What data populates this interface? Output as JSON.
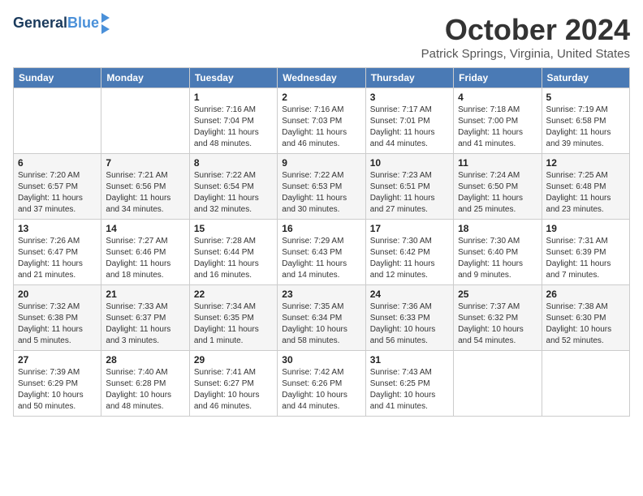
{
  "header": {
    "logo_line1": "General",
    "logo_line2": "Blue",
    "month_title": "October 2024",
    "location": "Patrick Springs, Virginia, United States"
  },
  "weekdays": [
    "Sunday",
    "Monday",
    "Tuesday",
    "Wednesday",
    "Thursday",
    "Friday",
    "Saturday"
  ],
  "weeks": [
    [
      {
        "day": "",
        "info": ""
      },
      {
        "day": "",
        "info": ""
      },
      {
        "day": "1",
        "info": "Sunrise: 7:16 AM\nSunset: 7:04 PM\nDaylight: 11 hours and 48 minutes."
      },
      {
        "day": "2",
        "info": "Sunrise: 7:16 AM\nSunset: 7:03 PM\nDaylight: 11 hours and 46 minutes."
      },
      {
        "day": "3",
        "info": "Sunrise: 7:17 AM\nSunset: 7:01 PM\nDaylight: 11 hours and 44 minutes."
      },
      {
        "day": "4",
        "info": "Sunrise: 7:18 AM\nSunset: 7:00 PM\nDaylight: 11 hours and 41 minutes."
      },
      {
        "day": "5",
        "info": "Sunrise: 7:19 AM\nSunset: 6:58 PM\nDaylight: 11 hours and 39 minutes."
      }
    ],
    [
      {
        "day": "6",
        "info": "Sunrise: 7:20 AM\nSunset: 6:57 PM\nDaylight: 11 hours and 37 minutes."
      },
      {
        "day": "7",
        "info": "Sunrise: 7:21 AM\nSunset: 6:56 PM\nDaylight: 11 hours and 34 minutes."
      },
      {
        "day": "8",
        "info": "Sunrise: 7:22 AM\nSunset: 6:54 PM\nDaylight: 11 hours and 32 minutes."
      },
      {
        "day": "9",
        "info": "Sunrise: 7:22 AM\nSunset: 6:53 PM\nDaylight: 11 hours and 30 minutes."
      },
      {
        "day": "10",
        "info": "Sunrise: 7:23 AM\nSunset: 6:51 PM\nDaylight: 11 hours and 27 minutes."
      },
      {
        "day": "11",
        "info": "Sunrise: 7:24 AM\nSunset: 6:50 PM\nDaylight: 11 hours and 25 minutes."
      },
      {
        "day": "12",
        "info": "Sunrise: 7:25 AM\nSunset: 6:48 PM\nDaylight: 11 hours and 23 minutes."
      }
    ],
    [
      {
        "day": "13",
        "info": "Sunrise: 7:26 AM\nSunset: 6:47 PM\nDaylight: 11 hours and 21 minutes."
      },
      {
        "day": "14",
        "info": "Sunrise: 7:27 AM\nSunset: 6:46 PM\nDaylight: 11 hours and 18 minutes."
      },
      {
        "day": "15",
        "info": "Sunrise: 7:28 AM\nSunset: 6:44 PM\nDaylight: 11 hours and 16 minutes."
      },
      {
        "day": "16",
        "info": "Sunrise: 7:29 AM\nSunset: 6:43 PM\nDaylight: 11 hours and 14 minutes."
      },
      {
        "day": "17",
        "info": "Sunrise: 7:30 AM\nSunset: 6:42 PM\nDaylight: 11 hours and 12 minutes."
      },
      {
        "day": "18",
        "info": "Sunrise: 7:30 AM\nSunset: 6:40 PM\nDaylight: 11 hours and 9 minutes."
      },
      {
        "day": "19",
        "info": "Sunrise: 7:31 AM\nSunset: 6:39 PM\nDaylight: 11 hours and 7 minutes."
      }
    ],
    [
      {
        "day": "20",
        "info": "Sunrise: 7:32 AM\nSunset: 6:38 PM\nDaylight: 11 hours and 5 minutes."
      },
      {
        "day": "21",
        "info": "Sunrise: 7:33 AM\nSunset: 6:37 PM\nDaylight: 11 hours and 3 minutes."
      },
      {
        "day": "22",
        "info": "Sunrise: 7:34 AM\nSunset: 6:35 PM\nDaylight: 11 hours and 1 minute."
      },
      {
        "day": "23",
        "info": "Sunrise: 7:35 AM\nSunset: 6:34 PM\nDaylight: 10 hours and 58 minutes."
      },
      {
        "day": "24",
        "info": "Sunrise: 7:36 AM\nSunset: 6:33 PM\nDaylight: 10 hours and 56 minutes."
      },
      {
        "day": "25",
        "info": "Sunrise: 7:37 AM\nSunset: 6:32 PM\nDaylight: 10 hours and 54 minutes."
      },
      {
        "day": "26",
        "info": "Sunrise: 7:38 AM\nSunset: 6:30 PM\nDaylight: 10 hours and 52 minutes."
      }
    ],
    [
      {
        "day": "27",
        "info": "Sunrise: 7:39 AM\nSunset: 6:29 PM\nDaylight: 10 hours and 50 minutes."
      },
      {
        "day": "28",
        "info": "Sunrise: 7:40 AM\nSunset: 6:28 PM\nDaylight: 10 hours and 48 minutes."
      },
      {
        "day": "29",
        "info": "Sunrise: 7:41 AM\nSunset: 6:27 PM\nDaylight: 10 hours and 46 minutes."
      },
      {
        "day": "30",
        "info": "Sunrise: 7:42 AM\nSunset: 6:26 PM\nDaylight: 10 hours and 44 minutes."
      },
      {
        "day": "31",
        "info": "Sunrise: 7:43 AM\nSunset: 6:25 PM\nDaylight: 10 hours and 41 minutes."
      },
      {
        "day": "",
        "info": ""
      },
      {
        "day": "",
        "info": ""
      }
    ]
  ]
}
